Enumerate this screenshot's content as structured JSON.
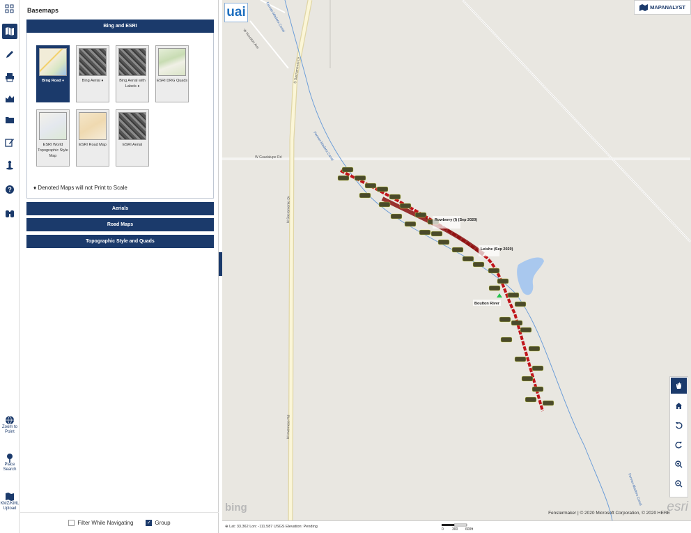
{
  "toolbar": {
    "zoom_to_point": "Zoom to Point",
    "place_search": "Place Search",
    "kmz_upload": "KMZ/KML Upload"
  },
  "panel": {
    "title": "Basemaps",
    "groups": [
      {
        "label": "Bing and ESRI"
      },
      {
        "label": "Aerials"
      },
      {
        "label": "Road Maps"
      },
      {
        "label": "Topographic Style and Quads"
      }
    ],
    "tiles": [
      {
        "label": "Bing Road ♦",
        "thumb": "road",
        "selected": true
      },
      {
        "label": "Bing Aerial ♦",
        "thumb": "aerial",
        "selected": false
      },
      {
        "label": "Bing Aerial with Labels ♦",
        "thumb": "aerial",
        "selected": false
      },
      {
        "label": "ESRI DRG Quads",
        "thumb": "quad",
        "selected": false
      },
      {
        "label": "ESRI World Topographic Style Map",
        "thumb": "topo",
        "selected": false
      },
      {
        "label": "ESRI Road Map",
        "thumb": "esriroad",
        "selected": false
      },
      {
        "label": "ESRI Aerial",
        "thumb": "aerial",
        "selected": false
      }
    ],
    "note": "♦ Denoted Maps will not Print to Scale",
    "footer": {
      "filter_label": "Filter While Navigating",
      "filter_checked": false,
      "group_label": "Group",
      "group_checked": true
    }
  },
  "map": {
    "logo": "uai",
    "brand": "MAPANALYST",
    "roads": [
      "W Houston Ave",
      "S Sacramento Dr",
      "W Guadalupe Rd",
      "N Sacramento Dr",
      "N Inverness Rd"
    ],
    "canal": "Fenner-Madera Canal",
    "callouts": [
      "Rowberry (I) (Sep 2020)",
      "Leishe (Sep 2020)",
      "Boulton River"
    ],
    "attribution": "Fenstermaker | © 2020 Microsoft Corporation, © 2020 HERE",
    "bing": "bing",
    "esri": "esri",
    "controls": [
      "pan-icon",
      "home-icon",
      "undo-icon",
      "redo-icon",
      "zoom-in-icon",
      "zoom-out-icon"
    ]
  },
  "status": {
    "text": "⊕ Lat: 33.362   Lon: -111.587   USGS Elevation: Pending",
    "scale_labels": [
      "0",
      "300",
      "600ft"
    ]
  },
  "colors": {
    "navy": "#1b3a6b",
    "pipeline": "#c0141a",
    "canal": "#6d9ed8"
  }
}
